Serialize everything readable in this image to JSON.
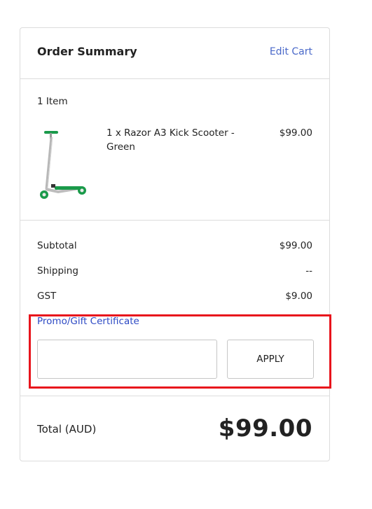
{
  "header": {
    "title": "Order Summary",
    "edit_cart_label": "Edit Cart"
  },
  "items": {
    "count_label": "1 Item",
    "products": [
      {
        "name": "1 x Razor A3 Kick Scooter - Green",
        "price": "$99.00",
        "image_icon": "scooter-image"
      }
    ]
  },
  "totals": {
    "subtotal_label": "Subtotal",
    "subtotal_value": "$99.00",
    "shipping_label": "Shipping",
    "shipping_value": "--",
    "gst_label": "GST",
    "gst_value": "$9.00"
  },
  "promo": {
    "link_label": "Promo/Gift Certificate",
    "input_value": "",
    "apply_label": "APPLY"
  },
  "grand_total": {
    "label": "Total (AUD)",
    "value": "$99.00"
  },
  "colors": {
    "link": "#4a69c9",
    "promo_link": "#2c49c4",
    "highlight": "#e8141c",
    "scooter_accent": "#1a9a4a"
  }
}
